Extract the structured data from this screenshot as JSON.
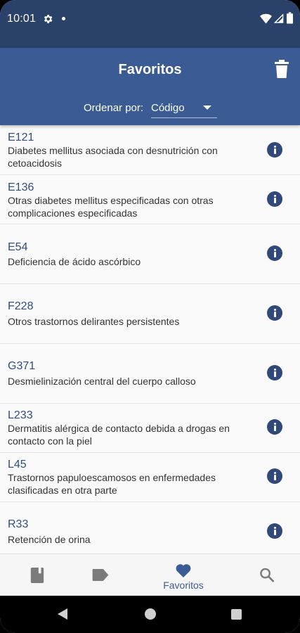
{
  "status": {
    "time": "10:01"
  },
  "app_bar": {
    "title": "Favoritos",
    "sort_label": "Ordenar por:",
    "sort_value": "Código"
  },
  "items": [
    {
      "code": "E121",
      "description": "Diabetes mellitus asociada con desnutrición con cetoacidosis"
    },
    {
      "code": "E136",
      "description": "Otras diabetes mellitus especificadas con otras complicaciones especificadas"
    },
    {
      "code": "E54",
      "description": "Deficiencia de ácido ascórbico"
    },
    {
      "code": "F228",
      "description": "Otros trastornos delirantes persistentes"
    },
    {
      "code": "G371",
      "description": "Desmielinización central del cuerpo calloso"
    },
    {
      "code": "L233",
      "description": "Dermatitis alérgica de contacto debida a drogas en contacto con la piel"
    },
    {
      "code": "L45",
      "description": "Trastornos papuloescamosos en enfermedades clasificadas en otra parte"
    },
    {
      "code": "R33",
      "description": "Retención de orina"
    }
  ],
  "bottom_nav": {
    "items": [
      {
        "icon": "book-icon",
        "label": ""
      },
      {
        "icon": "label-icon",
        "label": ""
      },
      {
        "icon": "heart-icon",
        "label": "Favoritos",
        "active": true
      },
      {
        "icon": "search-icon",
        "label": ""
      }
    ]
  },
  "colors": {
    "status_bar": "#2a4169",
    "app_bar": "#3a5b93",
    "code_text": "#2f4d80",
    "info_icon": "#30497a"
  }
}
